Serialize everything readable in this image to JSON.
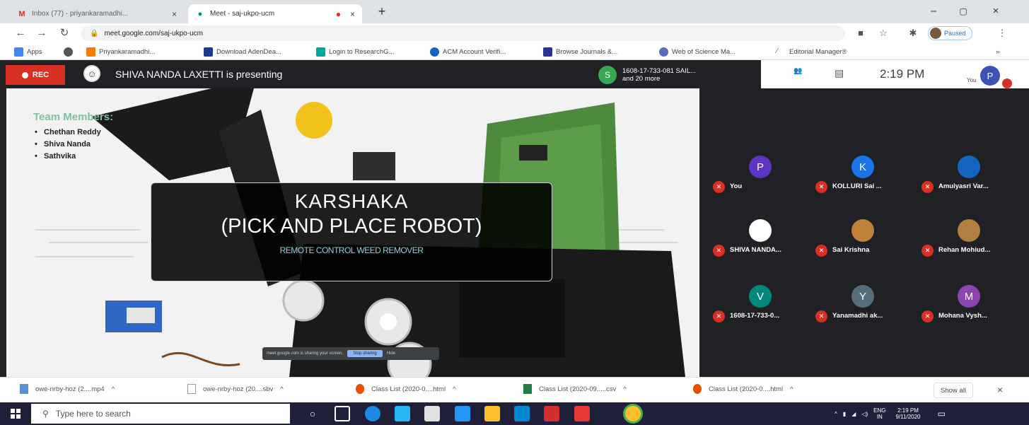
{
  "browser": {
    "tabs": [
      {
        "title": "Inbox (77) - priyankaramadhi... ",
        "favicon": "gmail-icon"
      },
      {
        "title": "Meet - saj-ukpo-ucm",
        "favicon": "meet-icon"
      }
    ],
    "url": "meet.google.com/saj-ukpo-ucm",
    "profile_label": "Paused",
    "bookmarks": [
      "Apps",
      "",
      "Priyankaramadhi...",
      "Download AdenDea...",
      "Login to ResearchG...",
      "ACM Account Verifi...",
      "Browse Journals &...",
      "Web of Science Ma...",
      "Editorial Manager®"
    ]
  },
  "meet": {
    "rec_label": "REC",
    "presenting_text": "SHIVA NANDA LAXETTI is presenting",
    "participants_chip": {
      "initial": "S",
      "line1": "1608-17-733-081 SAIL...",
      "line2": "and 20 more"
    },
    "time": "2:19 PM",
    "you_label": "You",
    "you_initial": "P",
    "slide": {
      "team_title": "Team Members:",
      "members": [
        "Chethan Reddy",
        "Shiva Nanda",
        "Sathvika"
      ],
      "title_line1": "KARSHAKA",
      "title_line2": "(PICK AND PLACE ROBOT)",
      "subtitle": "REMOTE CONTROL WEED REMOVER"
    },
    "share_notice": {
      "text": "meet.google.com is sharing your screen.",
      "button": "Stop sharing",
      "hide": "Hide"
    },
    "tiles": [
      {
        "initial": "P",
        "name": "You",
        "color": "#5c35c7"
      },
      {
        "initial": "K",
        "name": "KOLLURI Sai ...",
        "color": "#1a73e8"
      },
      {
        "initial": "",
        "name": "Amulyasri Var...",
        "color": "#1565c0"
      },
      {
        "initial": "",
        "name": "SHIVA NANDA...",
        "color": "#ffffff"
      },
      {
        "initial": "",
        "name": "Sai Krishna",
        "color": "#c0803a"
      },
      {
        "initial": "",
        "name": "Rehan Mohiud...",
        "color": "#b08040"
      },
      {
        "initial": "V",
        "name": "1608-17-733-0...",
        "color": "#00897b"
      },
      {
        "initial": "Y",
        "name": "Yanamadhi ak...",
        "color": "#546e7a"
      },
      {
        "initial": "M",
        "name": "Mohana Vysh...",
        "color": "#8e44ad"
      }
    ]
  },
  "downloads": {
    "items": [
      "owe-nrby-hoz (2....mp4",
      "owe-nrby-hoz (20....sbv",
      "Class List (2020-0....html",
      "Class List (2020-09.....csv",
      "Class List (2020-0....html"
    ],
    "show_all": "Show all"
  },
  "taskbar": {
    "search_placeholder": "Type here to search",
    "lang": "ENG",
    "region": "IN",
    "time": "2:19 PM",
    "date": "9/11/2020"
  }
}
